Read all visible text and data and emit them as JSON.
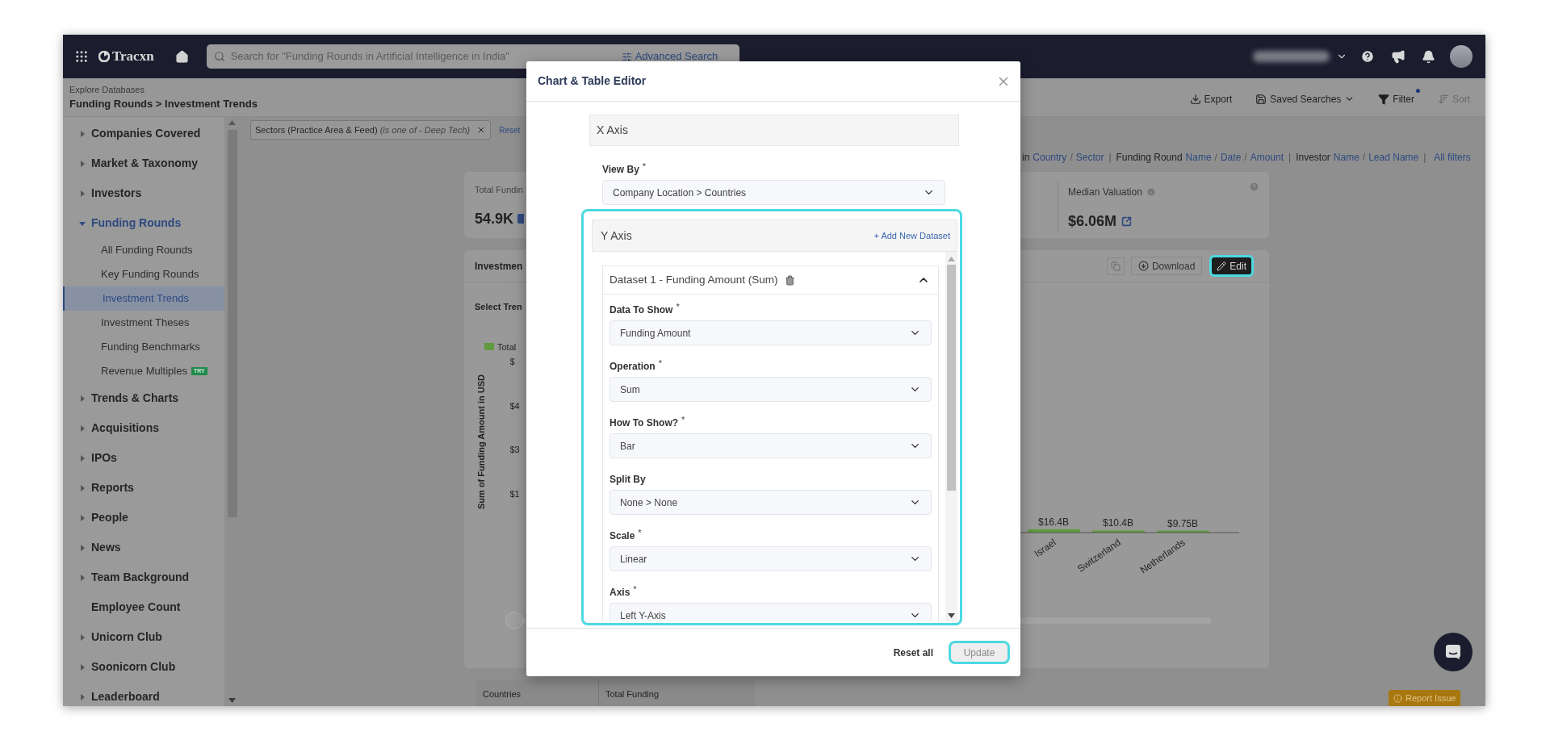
{
  "nav": {
    "logo": "Tracxn",
    "search": {
      "placeholder": "Search for \"Funding Rounds in Artificial Intelligence in India\""
    },
    "advanced_search": "Advanced Search"
  },
  "header": {
    "breadcrumb_top": "Explore Databases",
    "title": "Funding Rounds > Investment Trends",
    "actions": [
      {
        "label": "Export",
        "kind": "export",
        "disabled": false,
        "dot": false
      },
      {
        "label": "Saved Searches",
        "kind": "saved",
        "disabled": false,
        "dot": false
      },
      {
        "label": "Filter",
        "kind": "filter",
        "disabled": false,
        "dot": true
      },
      {
        "label": "Sort",
        "kind": "sort",
        "disabled": true,
        "dot": false
      }
    ]
  },
  "sidebar": {
    "items": [
      {
        "label": "Companies Covered",
        "expandable": true,
        "expanded": false
      },
      {
        "label": "Market & Taxonomy",
        "expandable": true,
        "expanded": false
      },
      {
        "label": "Investors",
        "expandable": true,
        "expanded": false
      },
      {
        "label": "Funding Rounds",
        "expandable": true,
        "expanded": true,
        "children": [
          {
            "label": "All Funding Rounds",
            "selected": false
          },
          {
            "label": "Key Funding Rounds",
            "selected": false
          },
          {
            "label": "Investment Trends",
            "selected": true
          },
          {
            "label": "Investment Theses",
            "selected": false
          },
          {
            "label": "Funding Benchmarks",
            "selected": false
          },
          {
            "label": "Revenue Multiples",
            "selected": false,
            "badge": "TRY"
          }
        ]
      },
      {
        "label": "Trends & Charts",
        "expandable": true,
        "expanded": false
      },
      {
        "label": "Acquisitions",
        "expandable": true,
        "expanded": false
      },
      {
        "label": "IPOs",
        "expandable": true,
        "expanded": false
      },
      {
        "label": "Reports",
        "expandable": true,
        "expanded": false
      },
      {
        "label": "People",
        "expandable": true,
        "expanded": false
      },
      {
        "label": "News",
        "expandable": true,
        "expanded": false
      },
      {
        "label": "Team Background",
        "expandable": true,
        "expanded": false
      },
      {
        "label": "Employee Count",
        "expandable": false,
        "expanded": false
      },
      {
        "label": "Unicorn Club",
        "expandable": true,
        "expanded": false
      },
      {
        "label": "Soonicorn Club",
        "expandable": true,
        "expanded": false
      },
      {
        "label": "Leaderboard",
        "expandable": true,
        "expanded": false
      }
    ]
  },
  "filters": {
    "chip": {
      "label": "Sectors (Practice Area & Feed)",
      "detail": "(is one of - Deep Tech)"
    },
    "reset": "Reset"
  },
  "filter_summary": {
    "link_separator": "/",
    "group_divider": "|",
    "groups": [
      {
        "name": "in",
        "links": [
          "Country",
          "Sector"
        ]
      },
      {
        "name": "Funding Round",
        "links": [
          "Name",
          "Date",
          "Amount"
        ]
      },
      {
        "name": "Investor",
        "links": [
          "Name",
          "Lead Name"
        ]
      }
    ],
    "all_filters": "All filters"
  },
  "stats": {
    "left": {
      "label": "Total Fundin",
      "value": "54.9K"
    },
    "right": {
      "label": "Median Valuation",
      "value": "$6.06M"
    }
  },
  "trend_panel": {
    "title": "Investmen",
    "actions": [
      {
        "kind": "copy",
        "highlighted": false
      },
      {
        "kind": "download",
        "label": "Download",
        "highlighted": false
      },
      {
        "kind": "edit",
        "label": "Edit",
        "highlighted": true
      }
    ],
    "select_label": "Select Tren",
    "legend": "Total",
    "y_axis_label": "Sum of Funding Amount in USD",
    "y_tick_fragments": [
      "$",
      "$4",
      "$3",
      "$1"
    ],
    "chart_data": {
      "type": "bar",
      "categories": [
        "Israel",
        "Switzerland",
        "Netherlands"
      ],
      "values": [
        16.4,
        10.4,
        9.75
      ],
      "value_labels": [
        "$16.4B",
        "$10.4B",
        "$9.75B"
      ]
    }
  },
  "table": {
    "columns": [
      "Countries",
      "Total Funding"
    ]
  },
  "report_issue": "Report Issue",
  "modal": {
    "title": "Chart & Table Editor",
    "required_marker": "*",
    "x_axis": {
      "title": "X Axis",
      "fields": [
        {
          "label": "View By",
          "required": true,
          "value": "Company Location > Countries"
        }
      ]
    },
    "y_axis": {
      "title": "Y Axis",
      "highlighted": true,
      "add_link": "+ Add New Dataset",
      "datasets": [
        {
          "title": "Dataset 1 - Funding Amount (Sum)",
          "expanded": true,
          "fields": [
            {
              "label": "Data To Show",
              "required": true,
              "value": "Funding Amount"
            },
            {
              "label": "Operation",
              "required": true,
              "value": "Sum"
            },
            {
              "label": "How To Show?",
              "required": true,
              "value": "Bar"
            },
            {
              "label": "Split By",
              "required": false,
              "value": "None > None"
            },
            {
              "label": "Scale",
              "required": true,
              "value": "Linear"
            },
            {
              "label": "Axis",
              "required": true,
              "value": "Left Y-Axis"
            }
          ]
        }
      ]
    },
    "footer": {
      "reset": "Reset all",
      "update": {
        "label": "Update",
        "disabled": true,
        "highlighted": true
      }
    }
  }
}
